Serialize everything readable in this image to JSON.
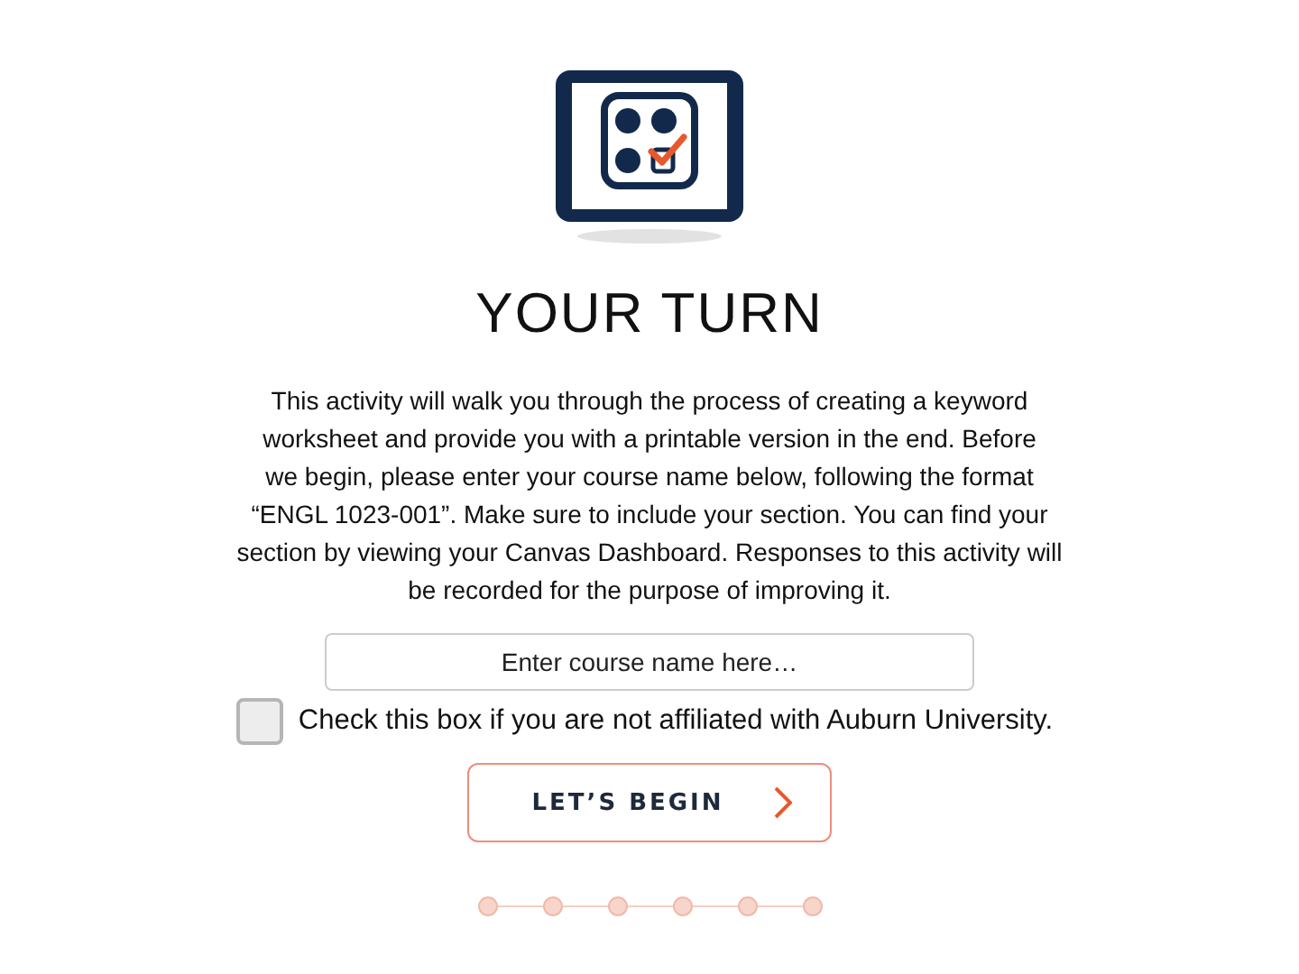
{
  "title": "YOUR TURN",
  "intro_lines": [
    "This activity will walk you through the process of creating a keyword",
    "worksheet and provide you with a printable version in the end. Before",
    "we begin, please enter your course name below, following the format",
    "“ENGL 1023-001”. Make sure to include your section. You can find your",
    "section by viewing your Canvas Dashboard. Responses to this activity will",
    "be recorded for the purpose of improving it."
  ],
  "course_field": {
    "placeholder": "Enter course name here…"
  },
  "affiliation_checkbox": {
    "label": "Check this box if you are not affiliated with Auburn University.",
    "checked": false
  },
  "begin_button": {
    "label": "LET’S BEGIN"
  },
  "progress_steps": [
    {
      "selected": false
    },
    {
      "selected": false
    },
    {
      "selected": false
    },
    {
      "selected": false
    },
    {
      "selected": false
    },
    {
      "selected": false
    }
  ]
}
